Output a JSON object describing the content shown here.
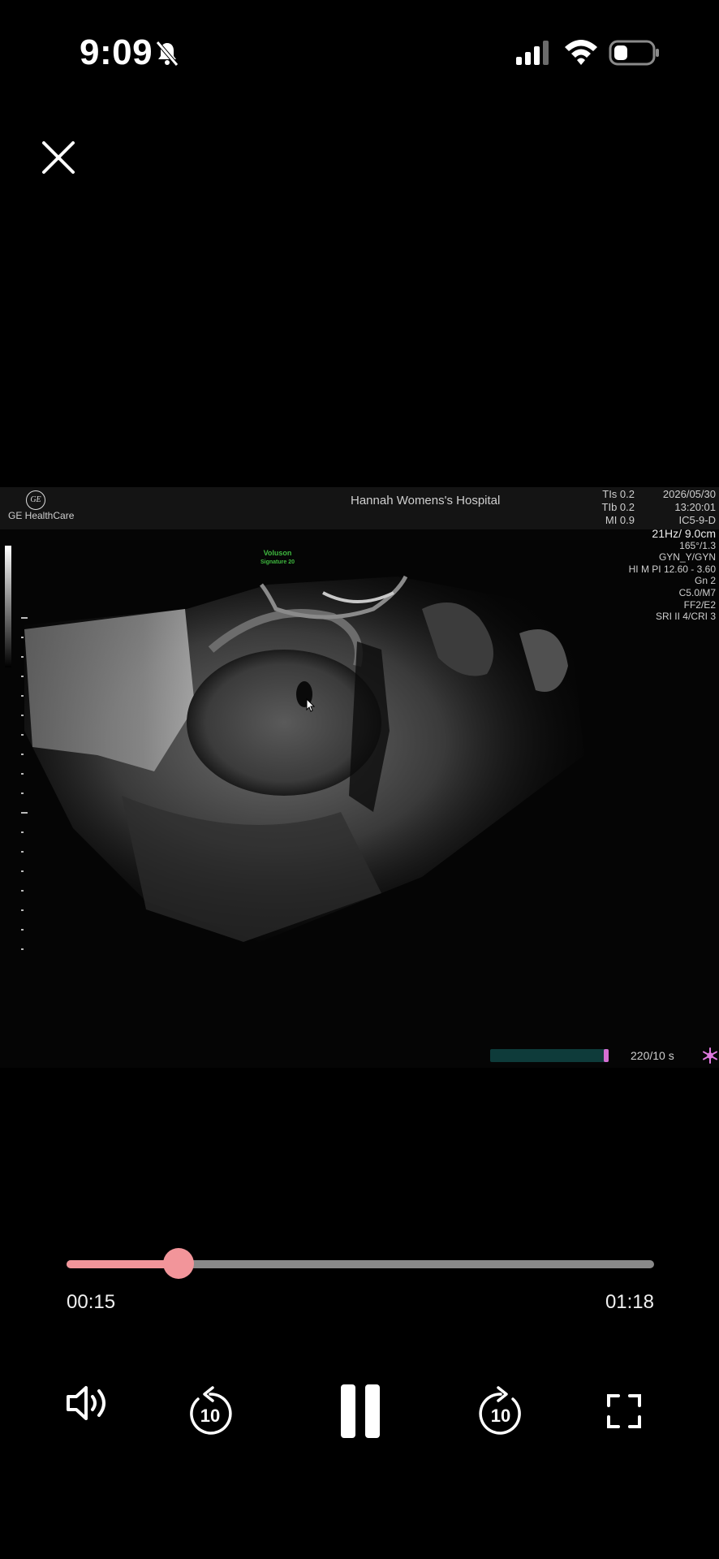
{
  "status_bar": {
    "time": "9:09"
  },
  "ultrasound": {
    "brand": "GE HealthCare",
    "hospital": "Hannah Womens's Hospital",
    "ti": [
      "TIs  0.2",
      "TIb  0.2",
      "MI  0.9"
    ],
    "datetime": [
      "2026/05/30",
      "13:20:01",
      "IC5-9-D"
    ],
    "params": [
      "21Hz/ 9.0cm",
      "165°/1.3",
      "GYN_Y/GYN",
      "HI M PI 12.60 - 3.60",
      "Gn  2",
      "C5.0/M7",
      "FF2/E2",
      "SRI II 4/CRI 3"
    ],
    "watermark": {
      "line1": "Voluson",
      "line2": "Signature 20"
    },
    "cine_label": "220/10 s",
    "cine_fraction": 0.96
  },
  "player": {
    "elapsed": "00:15",
    "total": "01:18",
    "progress": 0.19,
    "rewind_seconds": "10",
    "forward_seconds": "10"
  }
}
